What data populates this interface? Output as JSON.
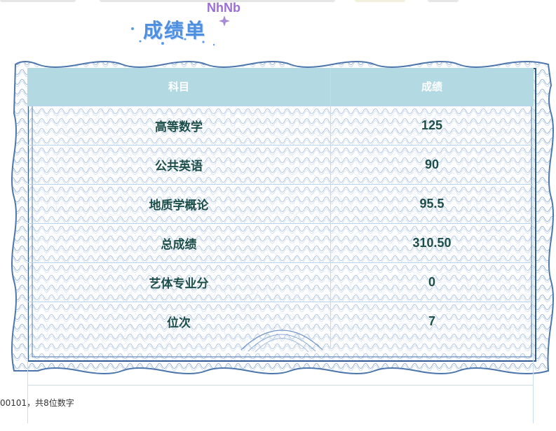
{
  "header": {
    "title": "成绩单",
    "brand": "NhNb"
  },
  "table": {
    "columns": [
      "科目",
      "成绩"
    ],
    "rows": [
      {
        "subject": "高等数学",
        "score": "125"
      },
      {
        "subject": "公共英语",
        "score": "90"
      },
      {
        "subject": "地质学概论",
        "score": "95.5"
      },
      {
        "subject": "总成绩",
        "score": "310.50"
      },
      {
        "subject": "艺体专业分",
        "score": "0"
      },
      {
        "subject": "位次",
        "score": "7"
      }
    ]
  },
  "footer": {
    "hint": "00101，共8位数字"
  },
  "colors": {
    "header_bg": "#b3d9e3",
    "text": "#1c4e4a",
    "frame": "#5a82b8",
    "title": "#4f8fe0"
  },
  "icons": [
    "sparkle-icon"
  ]
}
